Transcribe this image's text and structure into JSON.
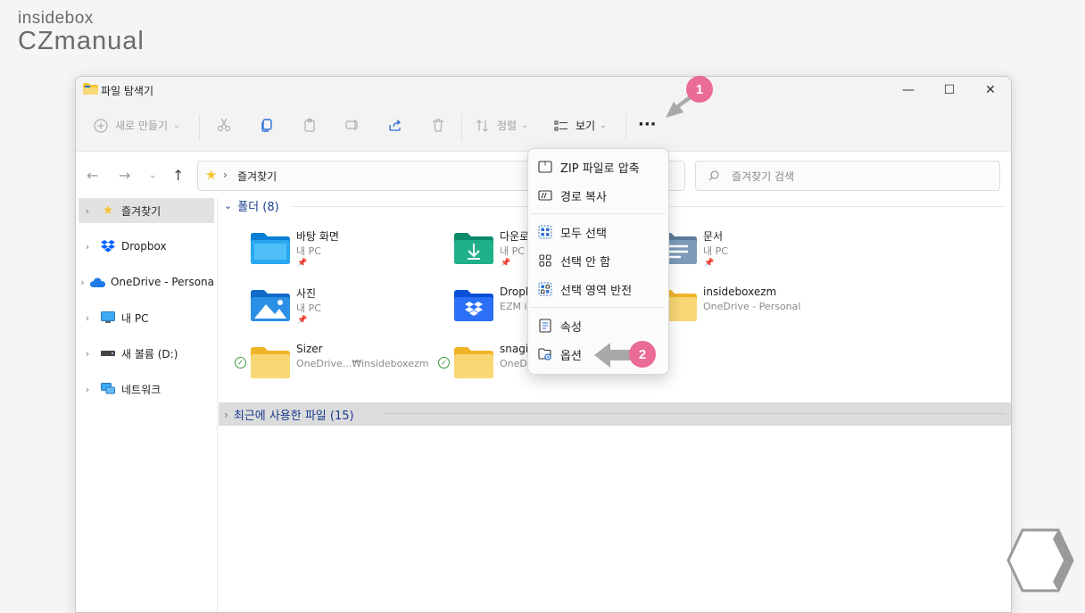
{
  "brand": {
    "line1": "insidebox",
    "line2": "CZmanual"
  },
  "window": {
    "title": "파일 탐색기",
    "controls": {
      "minimize": "—",
      "maximize": "☐",
      "close": "✕"
    }
  },
  "toolbar": {
    "new_label": "새로 만들기",
    "sort_label": "정렬",
    "view_label": "보기",
    "more_label": "···"
  },
  "address": {
    "path_label": "즐겨찾기",
    "search_placeholder": "즐겨찾기 검색"
  },
  "sidebar": {
    "items": [
      {
        "label": "즐겨찾기",
        "icon": "star-icon"
      },
      {
        "label": "Dropbox",
        "icon": "dropbox-icon"
      },
      {
        "label": "OneDrive - Persona",
        "icon": "onedrive-icon"
      },
      {
        "label": "내 PC",
        "icon": "pc-icon"
      },
      {
        "label": "새 볼륨 (D:)",
        "icon": "drive-icon"
      },
      {
        "label": "네트워크",
        "icon": "network-icon"
      }
    ]
  },
  "groups": {
    "folders_header": "폴더 (8)",
    "recent_header": "최근에 사용한 파일 (15)"
  },
  "folders": [
    {
      "name": "바탕 화면",
      "sub": "내 PC"
    },
    {
      "name": "다운로",
      "sub": "내 PC"
    },
    {
      "name": "문서",
      "sub": "내 PC"
    },
    {
      "name": "사진",
      "sub": "내 PC"
    },
    {
      "name": "Dropb",
      "sub": "EZM i"
    },
    {
      "name": "insideboxezm",
      "sub": "OneDrive - Personal"
    },
    {
      "name": "Sizer",
      "sub": "OneDrive...₩insideboxezm"
    },
    {
      "name": "snagit",
      "sub": "OneDrive...₩insideboxezm"
    }
  ],
  "menu": {
    "items": [
      {
        "label": "ZIP 파일로 압축",
        "icon": "zip-icon"
      },
      {
        "label": "경로 복사",
        "icon": "copy-path-icon"
      },
      {
        "label": "모두 선택",
        "icon": "select-all-icon"
      },
      {
        "label": "선택 안 함",
        "icon": "select-none-icon"
      },
      {
        "label": "선택 영역 반전",
        "icon": "invert-selection-icon"
      },
      {
        "label": "속성",
        "icon": "properties-icon"
      },
      {
        "label": "옵션",
        "icon": "options-icon"
      }
    ]
  },
  "annotations": {
    "step1": "1",
    "step2": "2"
  },
  "colors": {
    "accent": "#ea6a98",
    "group_header": "#1a3c8f",
    "folder_yellow": "#f8d775"
  }
}
